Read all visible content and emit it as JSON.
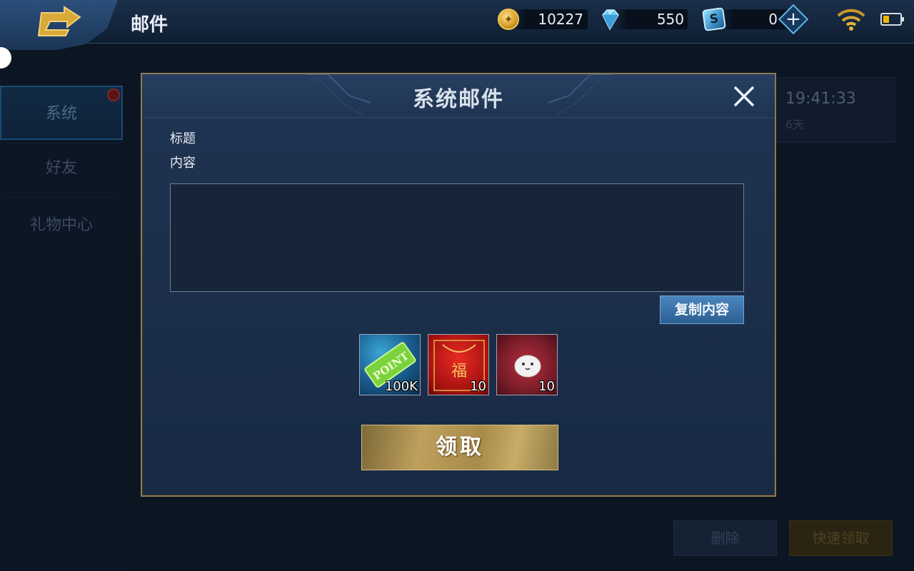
{
  "header": {
    "title": "邮件",
    "gold_amount": "10227",
    "diamond_amount": "550",
    "voucher_amount": "0"
  },
  "sidebar": {
    "items": [
      {
        "label": "系统"
      },
      {
        "label": "好友"
      },
      {
        "label": "礼物中心"
      }
    ]
  },
  "background_mail": {
    "time": "19:41:33",
    "days": "6天",
    "delete_label": "删除",
    "quick_claim_label": "快速领取"
  },
  "modal": {
    "title": "系统邮件",
    "subject_label": "标题",
    "content_label": "内容",
    "content_text": "",
    "copy_label": "复制内容",
    "rewards": [
      {
        "icon": "point-ticket-icon",
        "item_text": "POINT",
        "quantity": "100K"
      },
      {
        "icon": "red-envelope-icon",
        "item_text": "福",
        "quantity": "10"
      },
      {
        "icon": "white-pet-icon",
        "quantity": "10"
      }
    ],
    "claim_label": "领取"
  },
  "colors": {
    "accent_gold": "#c9ac67",
    "accent_blue": "#2d5f92",
    "panel_bg": "#1c2f4b"
  }
}
